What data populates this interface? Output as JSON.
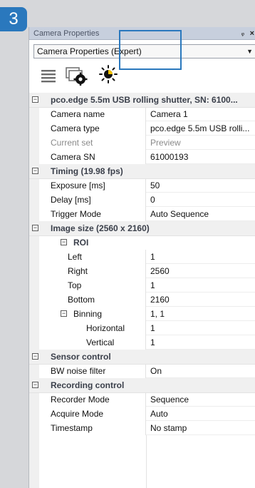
{
  "badge": "3",
  "panel": {
    "title": "Camera Properties",
    "pin_icon": "pin-icon",
    "close_icon": "close-icon",
    "dropdown_value": "Camera Properties (Expert)"
  },
  "toolbar": {
    "icons": [
      "list-view-icon",
      "settings-window-icon",
      "brightness-icon"
    ]
  },
  "properties": {
    "camera": {
      "title": "pco.edge 5.5m USB rolling shutter, SN: 6100...",
      "rows": [
        {
          "name": "Camera name",
          "value": "Camera 1"
        },
        {
          "name": "Camera type",
          "value": "pco.edge 5.5m USB rolli..."
        },
        {
          "name": "Current set",
          "value": "Preview"
        },
        {
          "name": "Camera SN",
          "value": "61000193"
        }
      ]
    },
    "timing": {
      "title": "Timing (19.98 fps)",
      "rows": [
        {
          "name": "Exposure [ms]",
          "value": "50"
        },
        {
          "name": "Delay [ms]",
          "value": "0"
        },
        {
          "name": "Trigger Mode",
          "value": "Auto Sequence"
        }
      ]
    },
    "image_size": {
      "title": "Image size (2560 x 2160)",
      "roi": {
        "title": "ROI",
        "rows": [
          {
            "name": "Left",
            "value": "1"
          },
          {
            "name": "Right",
            "value": "2560"
          },
          {
            "name": "Top",
            "value": "1"
          },
          {
            "name": "Bottom",
            "value": "2160"
          }
        ]
      },
      "binning": {
        "name": "Binning",
        "value": "1, 1",
        "rows": [
          {
            "name": "Horizontal",
            "value": "1"
          },
          {
            "name": "Vertical",
            "value": "1"
          }
        ]
      }
    },
    "sensor": {
      "title": "Sensor control",
      "rows": [
        {
          "name": "BW noise filter",
          "value": "On"
        }
      ]
    },
    "recording": {
      "title": "Recording control",
      "rows": [
        {
          "name": "Recorder Mode",
          "value": "Sequence"
        },
        {
          "name": "Acquire Mode",
          "value": "Auto"
        },
        {
          "name": "Timestamp",
          "value": "No stamp"
        }
      ]
    }
  },
  "colors": {
    "accent": "#2a78bd",
    "category_bg": "#f0f0f0",
    "muted_text": "#8a8a8a"
  }
}
